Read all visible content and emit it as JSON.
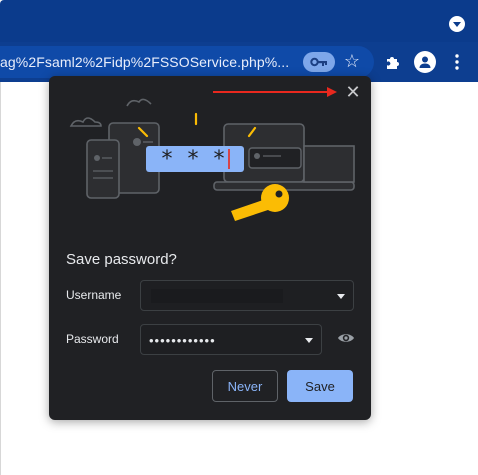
{
  "browser": {
    "url_text": "ag%2Fsaml2%2Fidp%2FSSOService.php%...",
    "icons": [
      "profile-dropdown-icon",
      "key-icon",
      "star-icon",
      "extensions-icon",
      "account-icon",
      "more-vert-icon"
    ]
  },
  "dialog": {
    "title": "Save password?",
    "username_label": "Username",
    "username_value": "",
    "password_label": "Password",
    "password_value": "••••••••••••",
    "never_label": "Never",
    "save_label": "Save",
    "illustration_password_mask": "* * *",
    "colors": {
      "accent": "#8ab4f8",
      "background": "#202124",
      "annotation_arrow": "#e8281e"
    }
  }
}
